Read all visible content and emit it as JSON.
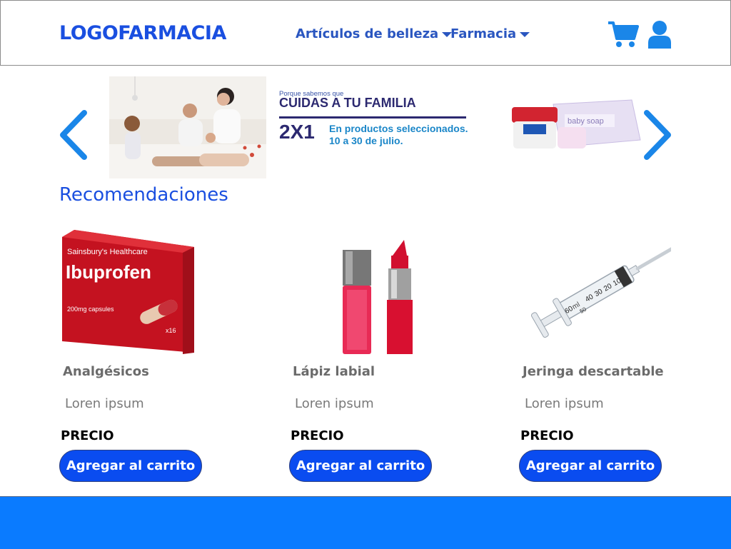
{
  "header": {
    "logo": "LOGOFARMACIA",
    "nav": [
      {
        "label": "Artículos de belleza"
      },
      {
        "label": "Farmacia"
      }
    ],
    "icons": {
      "cart": "cart-icon",
      "user": "user-icon"
    }
  },
  "banner": {
    "tagline_small": "Porque sabemos que",
    "headline": "CUIDAS A TU FAMILIA",
    "offer": "2X1",
    "description_line1": "En productos seleccionados.",
    "description_line2": "10 a 30 de julio.",
    "product_labels": {
      "soap": "baby soap"
    }
  },
  "recommendations": {
    "title": "Recomendaciones",
    "products": [
      {
        "name": "Analgésicos",
        "description": "Loren ipsum",
        "price_label": "PRECIO",
        "button": "Agregar al carrito",
        "box_brand": "Sainsbury's Healthcare",
        "box_name": "Ibuprofen",
        "box_dose": "200mg capsules",
        "box_count": "x16"
      },
      {
        "name": "Lápiz labial",
        "description": "Loren ipsum",
        "price_label": "PRECIO",
        "button": "Agregar al carrito"
      },
      {
        "name": "Jeringa descartable",
        "description": "Loren ipsum",
        "price_label": "PRECIO",
        "button": "Agregar al carrito",
        "scale_marks": [
          "10",
          "20",
          "30",
          "40",
          "50",
          "60"
        ],
        "scale_unit": "ml"
      }
    ]
  },
  "colors": {
    "primary": "#1a4fe0",
    "button": "#0a4cf0",
    "footer": "#0a7bff",
    "promo_dark": "#2c2970",
    "promo_light": "#1a86c8"
  }
}
